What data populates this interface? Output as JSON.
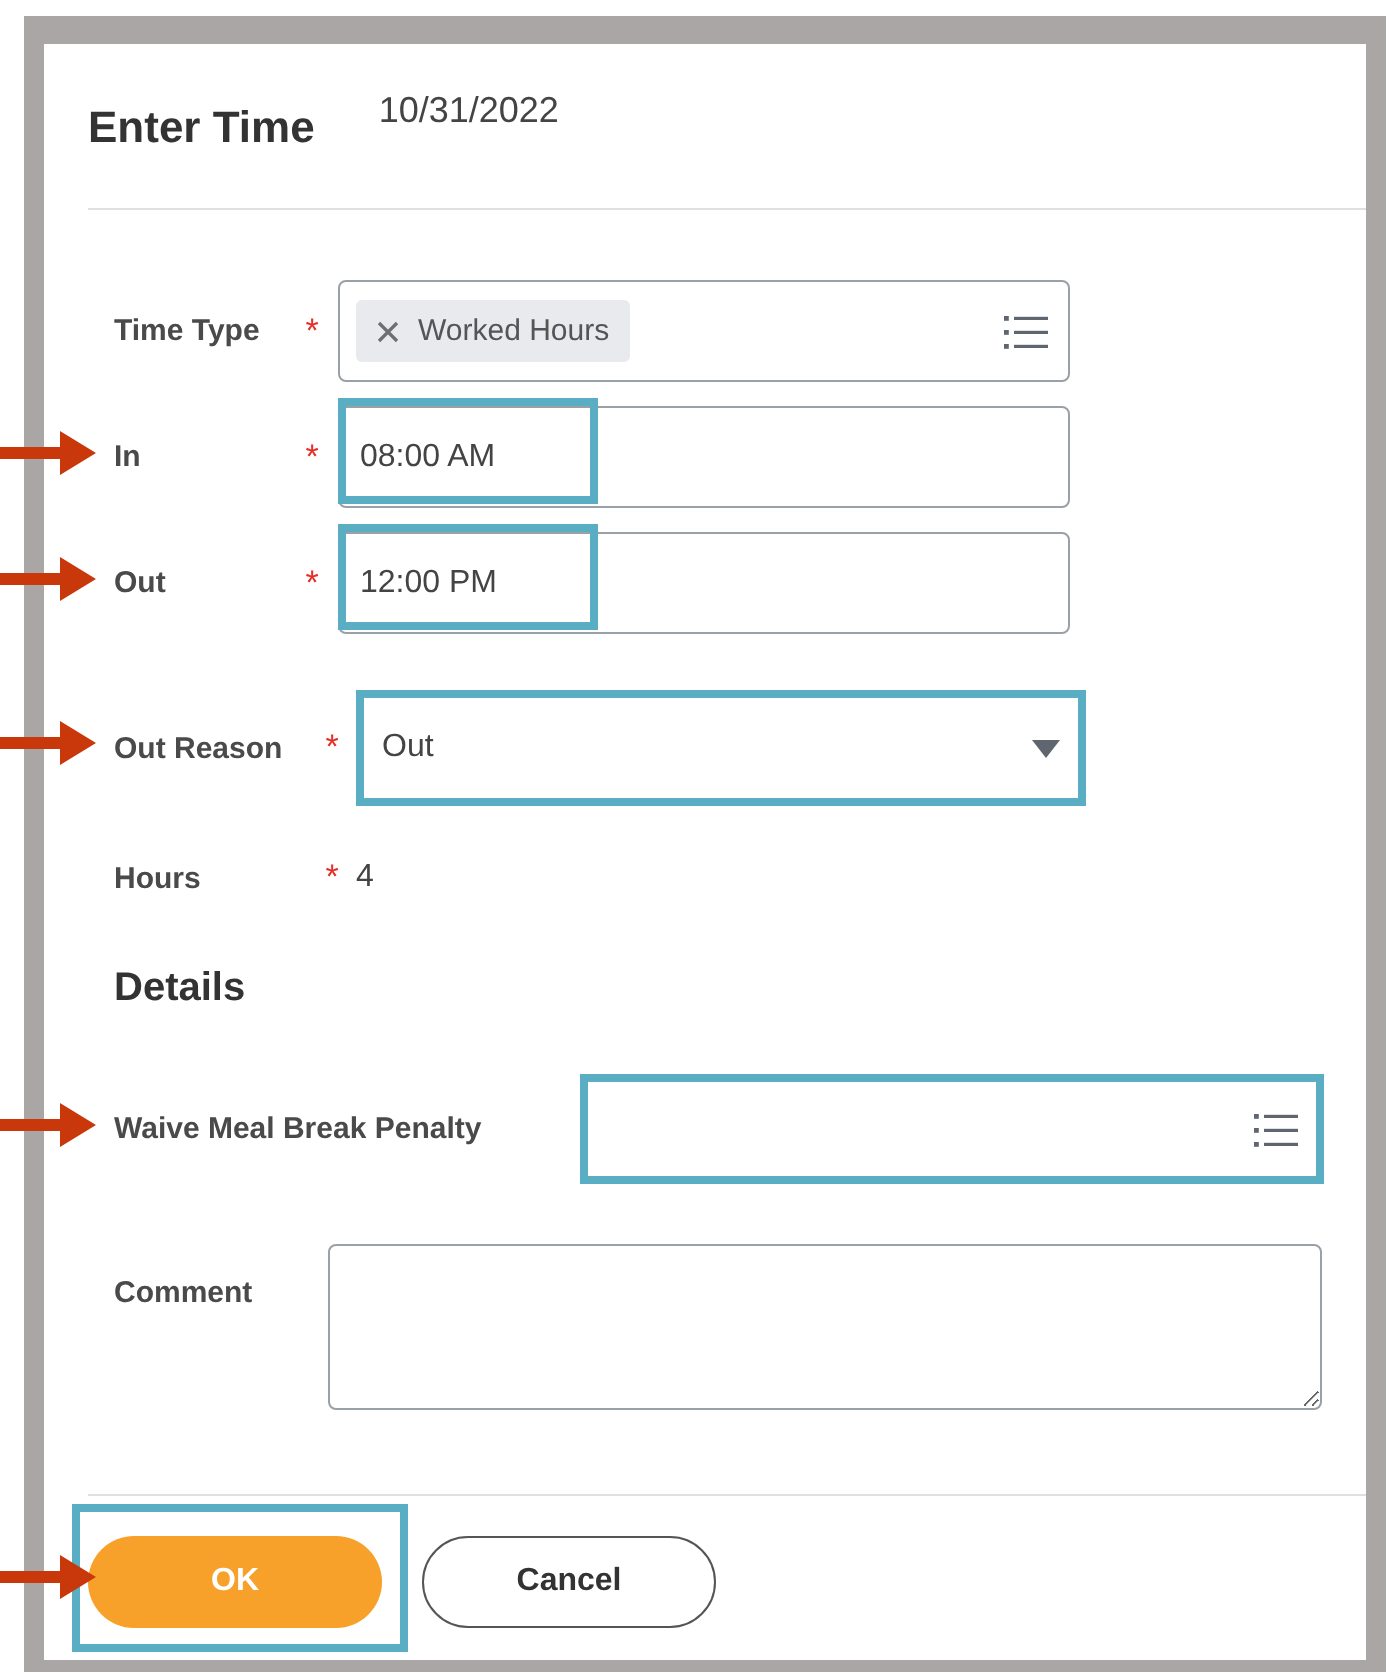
{
  "dialog": {
    "title": "Enter Time",
    "date": "10/31/2022"
  },
  "fields": [
    {
      "kind": "multiselect",
      "label": "Time Type",
      "required_mark": "*",
      "tokens": [
        "Worked Hours"
      ],
      "highlighted": false,
      "arrow": false
    },
    {
      "kind": "text",
      "label": "In",
      "required_mark": "*",
      "value": "08:00 AM",
      "highlighted": true,
      "arrow": true
    },
    {
      "kind": "text",
      "label": "Out",
      "required_mark": "*",
      "value": "12:00 PM",
      "highlighted": true,
      "arrow": true
    },
    {
      "kind": "dropdown",
      "label": "Out Reason",
      "required_mark": "*",
      "value": "Out",
      "highlighted": true,
      "arrow": true
    },
    {
      "kind": "readonly",
      "label": "Hours",
      "required_mark": "*",
      "value": "4",
      "highlighted": false,
      "arrow": false
    }
  ],
  "details": {
    "heading": "Details",
    "fields": [
      {
        "kind": "multiselect",
        "label": "Waive Meal Break Penalty",
        "highlighted": true,
        "arrow": true
      },
      {
        "kind": "textarea",
        "label": "Comment",
        "highlighted": false,
        "arrow": false
      }
    ]
  },
  "buttons": [
    {
      "label": "OK",
      "kind": "primary",
      "highlighted": true,
      "arrow": true
    },
    {
      "label": "Cancel",
      "kind": "secondary",
      "highlighted": false,
      "arrow": false
    }
  ]
}
